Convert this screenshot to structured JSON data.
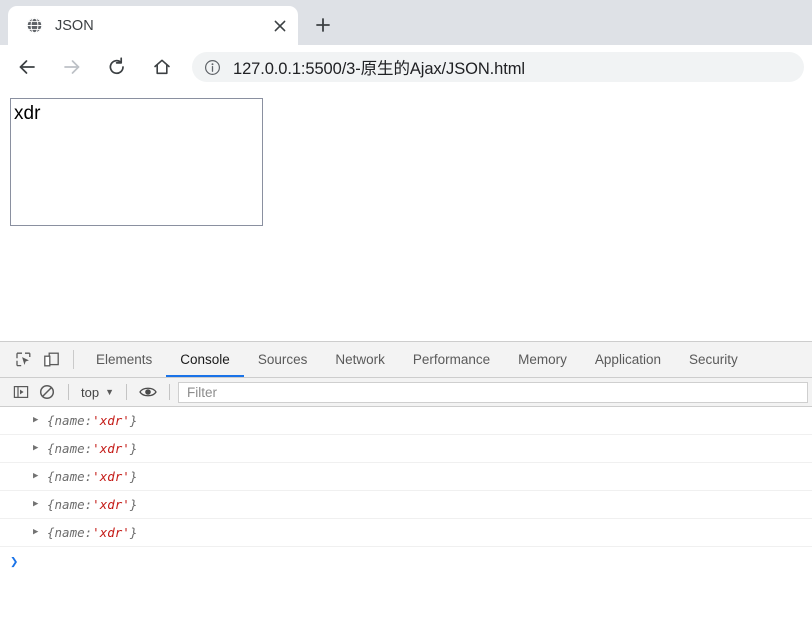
{
  "browser": {
    "tab": {
      "title": "JSON",
      "favicon_icon": "globe-icon",
      "close_icon": "close-icon"
    },
    "new_tab_label": "+",
    "nav": {
      "back_icon": "back-arrow-icon",
      "forward_icon": "forward-arrow-icon",
      "reload_icon": "reload-icon",
      "home_icon": "home-icon"
    },
    "omnibox": {
      "info_icon": "page-info-icon",
      "url": "127.0.0.1:5500/3-原生的Ajax/JSON.html"
    }
  },
  "page": {
    "box_text": "xdr"
  },
  "devtools": {
    "inspect_icon": "inspect-element-icon",
    "device_icon": "device-toolbar-icon",
    "tabs": [
      {
        "label": "Elements",
        "active": false
      },
      {
        "label": "Console",
        "active": true
      },
      {
        "label": "Sources",
        "active": false
      },
      {
        "label": "Network",
        "active": false
      },
      {
        "label": "Performance",
        "active": false
      },
      {
        "label": "Memory",
        "active": false
      },
      {
        "label": "Application",
        "active": false
      },
      {
        "label": "Security",
        "active": false
      }
    ],
    "toolbar": {
      "sidebar_icon": "console-sidebar-icon",
      "clear_icon": "clear-console-icon",
      "context": "top",
      "context_caret": "▼",
      "eye_icon": "live-expression-eye-icon",
      "filter_placeholder": "Filter"
    },
    "console": {
      "rows": [
        {
          "arrow": "▶",
          "open": "{",
          "key": "name:",
          "value": "'xdr'",
          "close": "}"
        },
        {
          "arrow": "▶",
          "open": "{",
          "key": "name:",
          "value": "'xdr'",
          "close": "}"
        },
        {
          "arrow": "▶",
          "open": "{",
          "key": "name:",
          "value": "'xdr'",
          "close": "}"
        },
        {
          "arrow": "▶",
          "open": "{",
          "key": "name:",
          "value": "'xdr'",
          "close": "}"
        },
        {
          "arrow": "▶",
          "open": "{",
          "key": "name:",
          "value": "'xdr'",
          "close": "}"
        }
      ],
      "prompt_caret": "❯"
    }
  },
  "colors": {
    "accent": "#1a73e8",
    "string_value": "#c41a16",
    "tabstrip_bg": "#dee1e6",
    "omnibox_bg": "#f1f3f4",
    "devtools_bg": "#f3f3f3"
  }
}
